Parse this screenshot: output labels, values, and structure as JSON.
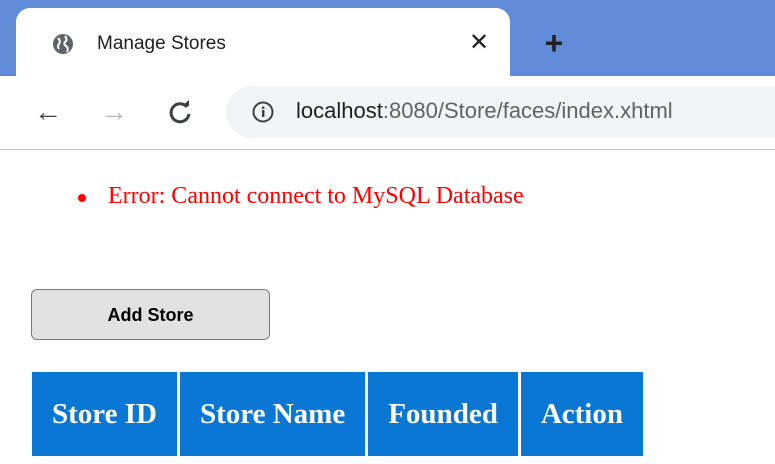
{
  "browser": {
    "tab": {
      "title": "Manage Stores",
      "icon": "globe-icon",
      "close_glyph": "✕"
    },
    "new_tab_glyph": "+",
    "nav": {
      "back_glyph": "←",
      "forward_glyph": "→",
      "reload_glyph": "C"
    },
    "address": {
      "host": "localhost",
      "rest": ":8080/Store/faces/index.xhtml"
    }
  },
  "page": {
    "errors": [
      "Error: Cannot connect to MySQL Database"
    ],
    "add_button_label": "Add Store",
    "table": {
      "headers": [
        "Store ID",
        "Store Name",
        "Founded",
        "Action"
      ]
    }
  },
  "colors": {
    "error_text": "#ff0000",
    "table_header_bg": "#0b77d5",
    "tabstrip_bg": "#5f8bd9"
  }
}
